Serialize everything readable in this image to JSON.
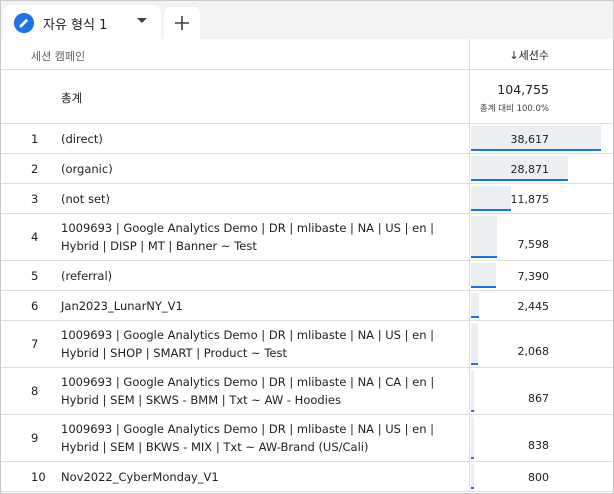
{
  "tab": {
    "label": "자유 형식 1",
    "icon": "pencil-icon",
    "add_icon": "plus-icon"
  },
  "header": {
    "dimension": "세션 캠페인",
    "metric_arrow": "↓",
    "metric": "세션수"
  },
  "total": {
    "label": "총계",
    "value": "104,755",
    "sub": "총계 대비 100.0%"
  },
  "chart_data": {
    "type": "table",
    "columns": [
      "세션 캠페인",
      "세션수"
    ],
    "max": 38617,
    "rows": [
      {
        "index": "1",
        "name": "(direct)",
        "value": "38,617",
        "num": 38617
      },
      {
        "index": "2",
        "name": "(organic)",
        "value": "28,871",
        "num": 28871
      },
      {
        "index": "3",
        "name": "(not set)",
        "value": "11,875",
        "num": 11875
      },
      {
        "index": "4",
        "name": "1009693 | Google Analytics Demo | DR | mlibaste | NA | US | en | Hybrid | DISP | MT | Banner ~ Test",
        "value": "7,598",
        "num": 7598
      },
      {
        "index": "5",
        "name": "(referral)",
        "value": "7,390",
        "num": 7390
      },
      {
        "index": "6",
        "name": "Jan2023_LunarNY_V1",
        "value": "2,445",
        "num": 2445
      },
      {
        "index": "7",
        "name": "1009693 | Google Analytics Demo | DR | mlibaste | NA | US | en | Hybrid | SHOP | SMART | Product ~ Test",
        "value": "2,068",
        "num": 2068
      },
      {
        "index": "8",
        "name": "1009693 | Google Analytics Demo | DR | mlibaste | NA | CA | en | Hybrid | SEM | SKWS - BMM | Txt ~ AW - Hoodies",
        "value": "867",
        "num": 867
      },
      {
        "index": "9",
        "name": "1009693 | Google Analytics Demo | DR | mlibaste | NA | US | en | Hybrid | SEM | BKWS - MIX | Txt ~ AW-Brand (US/Cali)",
        "value": "838",
        "num": 838
      },
      {
        "index": "10",
        "name": "Nov2022_CyberMonday_V1",
        "value": "800",
        "num": 800
      }
    ]
  },
  "colors": {
    "accent": "#1a73e8",
    "bar_fill": "#eceff1"
  }
}
